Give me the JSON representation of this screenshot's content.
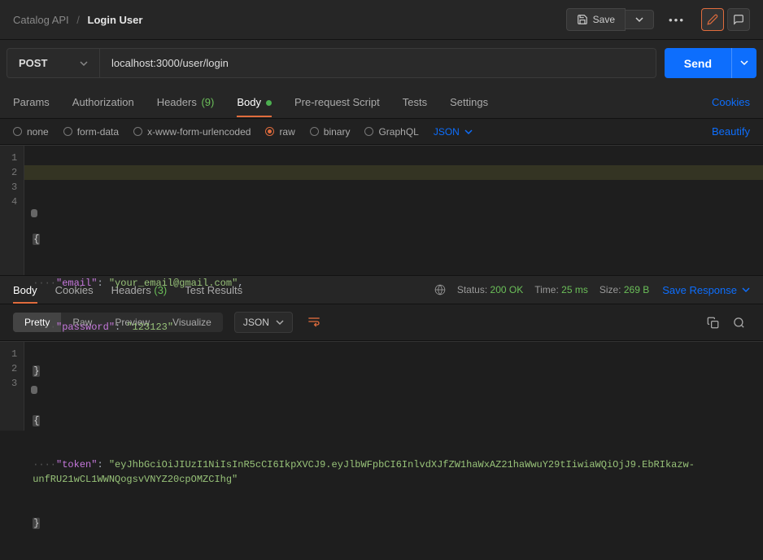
{
  "breadcrumb": {
    "parent": "Catalog API",
    "current": "Login User"
  },
  "topbar": {
    "save_label": "Save"
  },
  "request": {
    "method": "POST",
    "url": "localhost:3000/user/login",
    "send_label": "Send"
  },
  "tabs": {
    "params": "Params",
    "authorization": "Authorization",
    "headers": "Headers",
    "headers_count": "(9)",
    "body": "Body",
    "prereq": "Pre-request Script",
    "tests": "Tests",
    "settings": "Settings",
    "cookies_link": "Cookies",
    "active": "body"
  },
  "body_types": {
    "none": "none",
    "form_data": "form-data",
    "x_www": "x-www-form-urlencoded",
    "raw": "raw",
    "binary": "binary",
    "graphql": "GraphQL",
    "selected": "raw",
    "format": "JSON",
    "beautify": "Beautify"
  },
  "request_body": {
    "lines": [
      "1",
      "2",
      "3",
      "4"
    ],
    "l1_brace": "{",
    "l2_indent": "····",
    "l2_key": "\"email\"",
    "l2_colon": ":",
    "l2_val": "\"your_email@gmail.com\"",
    "l2_comma": ",",
    "l3_indent": "····",
    "l3_key": "\"password\"",
    "l3_colon": ":",
    "l3_val": "\"123123\"",
    "l4_brace": "}"
  },
  "response_tabs": {
    "body": "Body",
    "cookies": "Cookies",
    "headers": "Headers",
    "headers_count": "(3)",
    "test_results": "Test Results",
    "active": "body"
  },
  "response_meta": {
    "status_label": "Status:",
    "status_value": "200 OK",
    "time_label": "Time:",
    "time_value": "25 ms",
    "size_label": "Size:",
    "size_value": "269 B",
    "save_response": "Save Response"
  },
  "response_toolbar": {
    "pretty": "Pretty",
    "raw": "Raw",
    "preview": "Preview",
    "visualize": "Visualize",
    "format": "JSON"
  },
  "response_body": {
    "lines": [
      "1",
      "2",
      "3"
    ],
    "l1_brace": "{",
    "l2_indent": "····",
    "l2_key": "\"token\"",
    "l2_colon": ":",
    "l2_val": "\"eyJhbGciOiJIUzI1NiIsInR5cCI6IkpXVCJ9.eyJlbWFpbCI6InlvdXJfZW1haWxAZ21haWwuY29tIiwiaWQiOjJ9.EbRIkazw-unfRU21wCL1WWNQogsvVNYZ20cpOMZCIhg\"",
    "l3_brace": "}"
  }
}
